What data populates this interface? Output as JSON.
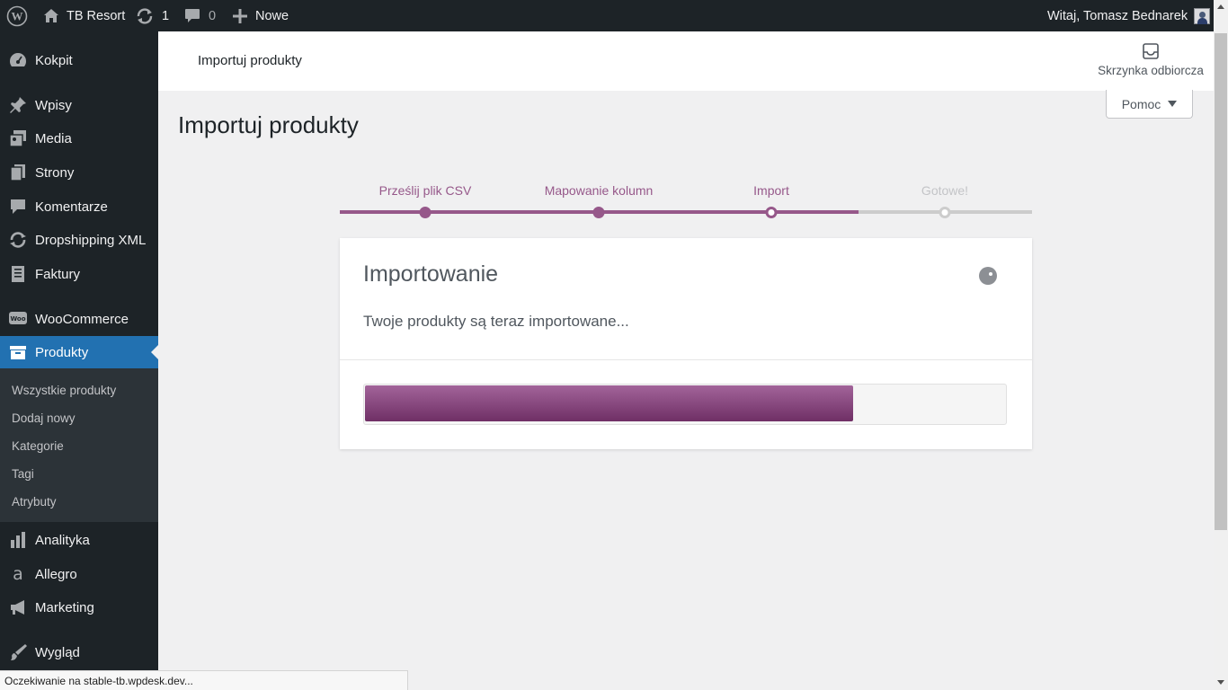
{
  "adminbar": {
    "site_name": "TB Resort",
    "updates_count": "1",
    "comments_count": "0",
    "new_label": "Nowe",
    "greeting": "Witaj, Tomasz Bednarek"
  },
  "sidebar": {
    "items": [
      {
        "label": "Kokpit",
        "icon": "dashboard-icon"
      },
      {
        "label": "Wpisy",
        "icon": "pin-icon"
      },
      {
        "label": "Media",
        "icon": "media-icon"
      },
      {
        "label": "Strony",
        "icon": "pages-icon"
      },
      {
        "label": "Komentarze",
        "icon": "comment-icon"
      },
      {
        "label": "Dropshipping XML",
        "icon": "sync-icon"
      },
      {
        "label": "Faktury",
        "icon": "invoice-icon"
      },
      {
        "label": "WooCommerce",
        "icon": "woo-icon"
      },
      {
        "label": "Produkty",
        "icon": "archive-icon"
      },
      {
        "label": "Analityka",
        "icon": "chart-icon"
      },
      {
        "label": "Allegro",
        "icon": "allegro-icon"
      },
      {
        "label": "Marketing",
        "icon": "megaphone-icon"
      },
      {
        "label": "Wygląd",
        "icon": "brush-icon"
      }
    ],
    "submenu": [
      "Wszystkie produkty",
      "Dodaj nowy",
      "Kategorie",
      "Tagi",
      "Atrybuty"
    ]
  },
  "header": {
    "title": "Importuj produkty",
    "inbox_label": "Skrzynka odbiorcza",
    "help_label": "Pomoc"
  },
  "page": {
    "title": "Importuj produkty"
  },
  "steps": {
    "items": [
      {
        "label": "Prześlij plik CSV",
        "state": "done"
      },
      {
        "label": "Mapowanie kolumn",
        "state": "done"
      },
      {
        "label": "Import",
        "state": "current"
      },
      {
        "label": "Gotowe!",
        "state": "todo"
      }
    ]
  },
  "card": {
    "title": "Importowanie",
    "description": "Twoje produkty są teraz importowane...",
    "progress_fraction": 0.763
  },
  "statusbar": {
    "text": "Oczekiwanie na stable-tb.wpdesk.dev..."
  },
  "colors": {
    "accent": "#96588a",
    "admin_bar": "#1d2327",
    "active_menu": "#2271b1"
  }
}
